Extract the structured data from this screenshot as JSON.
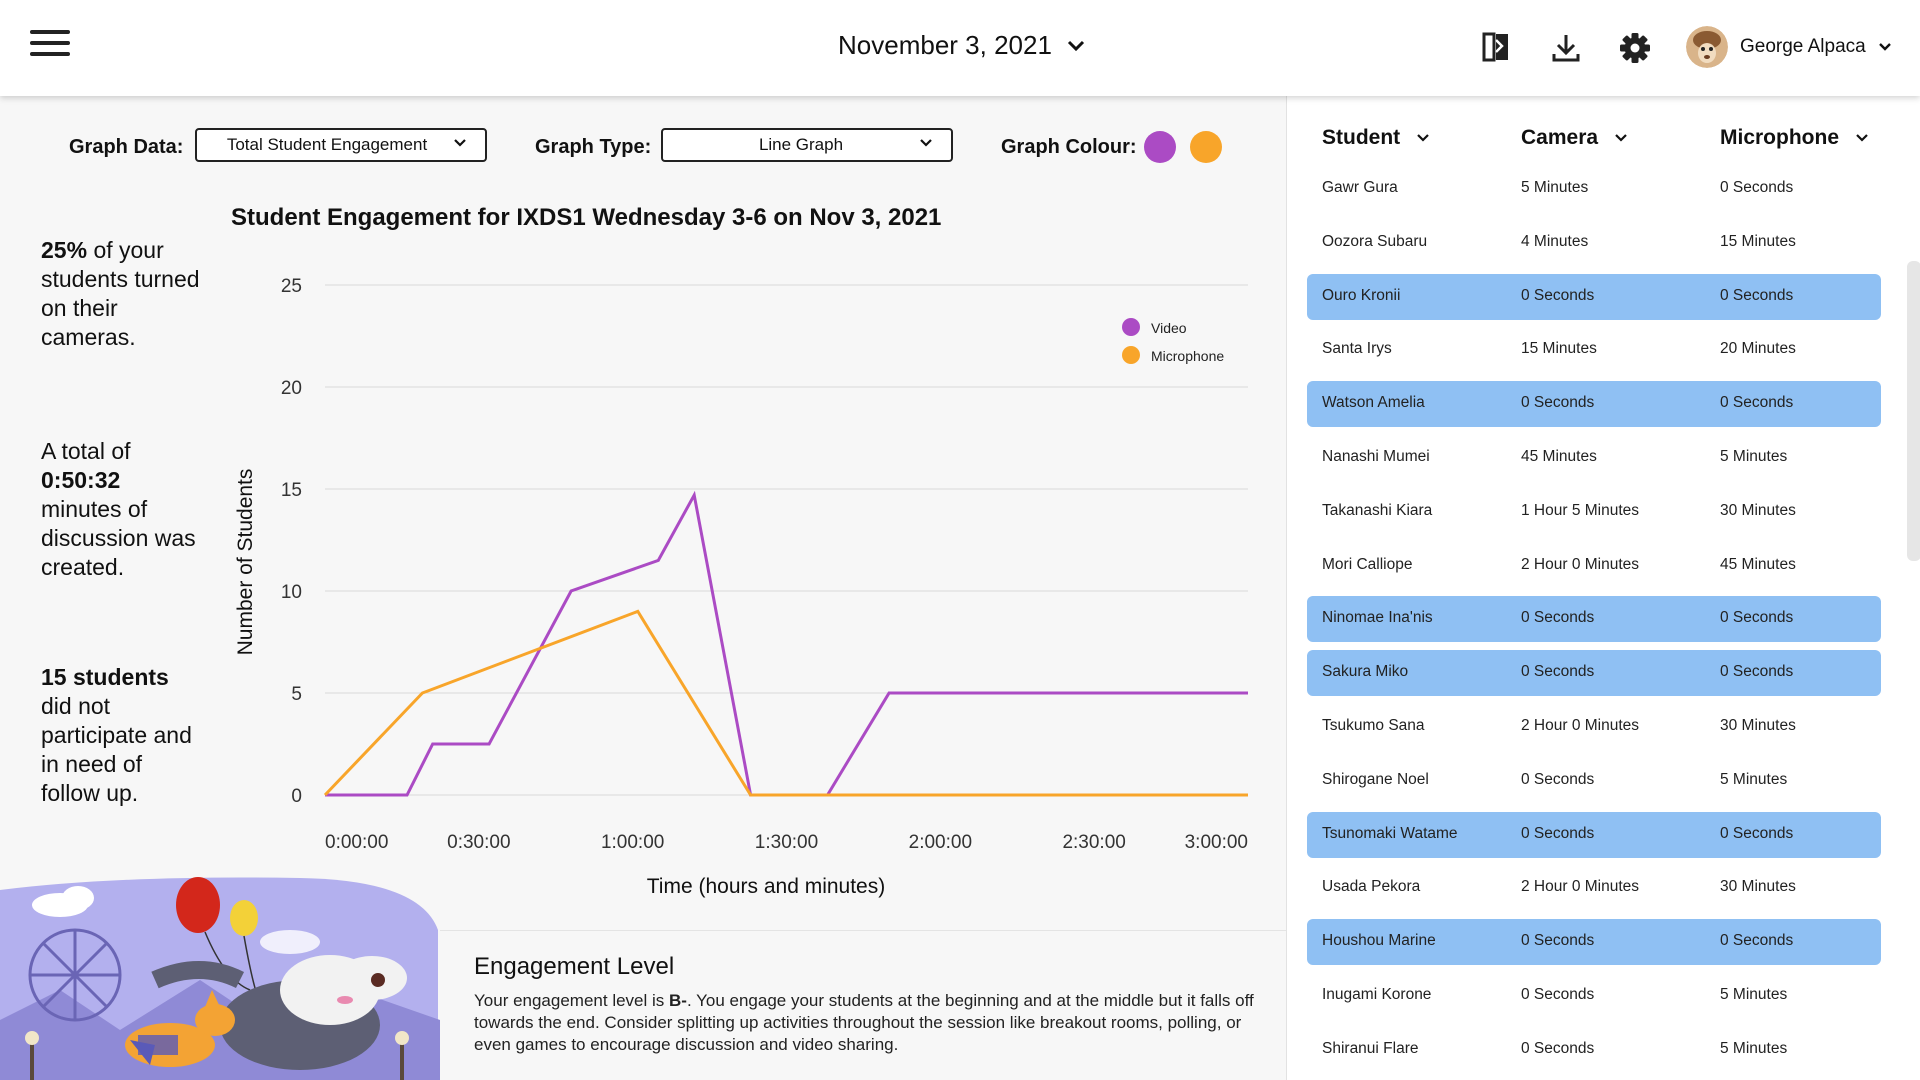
{
  "header": {
    "date": "November 3, 2021",
    "user_name": "George Alpaca",
    "icons": [
      "compare-icon",
      "download-icon",
      "gear-icon"
    ]
  },
  "filters": {
    "graph_data_label": "Graph Data:",
    "graph_data_value": "Total Student Engagement",
    "graph_type_label": "Graph Type:",
    "graph_type_value": "Line Graph",
    "graph_colour_label": "Graph Colour:",
    "colours": [
      "#ab4bc4",
      "#f8a52a"
    ]
  },
  "stats": {
    "cam_pct": "25%",
    "cam_text": "of your students turned on their cameras.",
    "disc_pre": "A total of",
    "disc_time": "0:50:32",
    "disc_post": "minutes of discussion was created.",
    "nonpart_count": "15 students",
    "nonpart_text": "did not participate and in need of follow up."
  },
  "chart_data": {
    "type": "line",
    "title": "Student Engagement for IXDS1 Wednesday 3-6 on Nov 3, 2021",
    "xlabel": "Time (hours and minutes)",
    "ylabel": "Number of Students",
    "x_tick_labels": [
      "0:00:00",
      "0:30:00",
      "1:00:00",
      "1:30:00",
      "2:00:00",
      "2:30:00",
      "3:00:00"
    ],
    "y_ticks": [
      0,
      5,
      10,
      15,
      20,
      25
    ],
    "xlim": [
      0,
      180
    ],
    "ylim": [
      0,
      25
    ],
    "grid": true,
    "legend": "top-right",
    "series": [
      {
        "name": "Video",
        "color": "#ab4bc4",
        "x": [
          0,
          16,
          21,
          32,
          48,
          65,
          72,
          83,
          98,
          110,
          180
        ],
        "y": [
          0,
          0,
          2.5,
          2.5,
          10,
          11.5,
          14.7,
          0,
          0,
          5,
          5
        ]
      },
      {
        "name": "Microphone",
        "color": "#f8a52a",
        "x": [
          0,
          19,
          61,
          83,
          180
        ],
        "y": [
          0,
          5,
          9,
          0,
          0
        ]
      }
    ]
  },
  "engagement": {
    "title": "Engagement Level",
    "text_before": "Your engagement level is ",
    "grade": "B-",
    "text_after": ". You engage your students at the beginning and at the middle but it falls off towards the end. Consider splitting up activities throughout the session like breakout rooms, polling, or even games to encourage discussion and video sharing."
  },
  "table": {
    "columns": [
      "Student",
      "Camera",
      "Microphone"
    ],
    "rows": [
      {
        "student": "Gawr Gura",
        "camera": "5 Minutes",
        "mic": "0 Seconds",
        "highlight": false
      },
      {
        "student": "Oozora Subaru",
        "camera": "4 Minutes",
        "mic": "15 Minutes",
        "highlight": false
      },
      {
        "student": "Ouro Kronii",
        "camera": "0 Seconds",
        "mic": "0 Seconds",
        "highlight": true
      },
      {
        "student": "Santa Irys",
        "camera": "15 Minutes",
        "mic": "20 Minutes",
        "highlight": false
      },
      {
        "student": "Watson Amelia",
        "camera": "0 Seconds",
        "mic": "0 Seconds",
        "highlight": true
      },
      {
        "student": "Nanashi Mumei",
        "camera": "45 Minutes",
        "mic": "5 Minutes",
        "highlight": false
      },
      {
        "student": "Takanashi Kiara",
        "camera": "1 Hour 5 Minutes",
        "mic": "30 Minutes",
        "highlight": false
      },
      {
        "student": "Mori Calliope",
        "camera": "2 Hour 0 Minutes",
        "mic": "45 Minutes",
        "highlight": false
      },
      {
        "student": "Ninomae Ina'nis",
        "camera": "0 Seconds",
        "mic": "0 Seconds",
        "highlight": true
      },
      {
        "student": "Sakura Miko",
        "camera": "0 Seconds",
        "mic": "0 Seconds",
        "highlight": true
      },
      {
        "student": "Tsukumo Sana",
        "camera": "2 Hour 0 Minutes",
        "mic": "30 Minutes",
        "highlight": false
      },
      {
        "student": "Shirogane Noel",
        "camera": "0 Seconds",
        "mic": "5 Minutes",
        "highlight": false
      },
      {
        "student": "Tsunomaki Watame",
        "camera": "0 Seconds",
        "mic": "0 Seconds",
        "highlight": true
      },
      {
        "student": "Usada Pekora",
        "camera": "2 Hour 0 Minutes",
        "mic": "30 Minutes",
        "highlight": false
      },
      {
        "student": "Houshou Marine",
        "camera": "0 Seconds",
        "mic": "0 Seconds",
        "highlight": true
      },
      {
        "student": "Inugami Korone",
        "camera": "0 Seconds",
        "mic": "5 Minutes",
        "highlight": false
      },
      {
        "student": "Shiranui Flare",
        "camera": "0 Seconds",
        "mic": "5 Minutes",
        "highlight": false
      }
    ]
  }
}
